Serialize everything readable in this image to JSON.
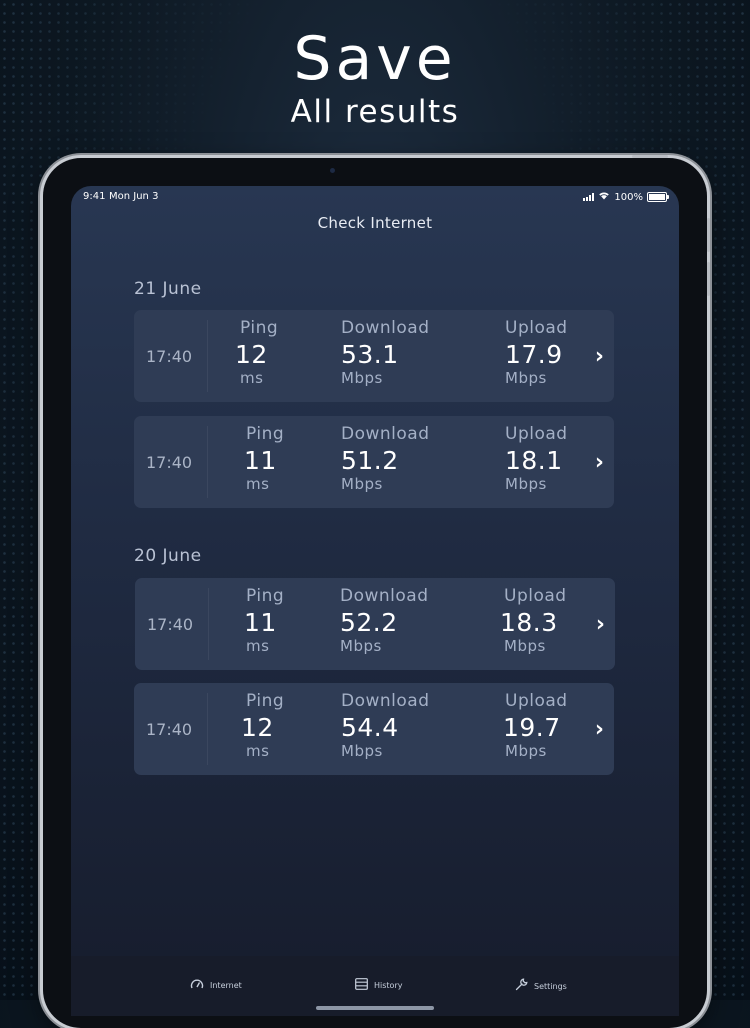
{
  "promo": {
    "headline": "Save",
    "subline": "All results"
  },
  "status_bar": {
    "time": "9:41",
    "date": "Mon Jun 3",
    "battery": "100%"
  },
  "nav": {
    "title": "Check Internet"
  },
  "labels": {
    "ping": "Ping",
    "download": "Download",
    "upload": "Upload",
    "ms": "ms",
    "mbps": "Mbps"
  },
  "sections": [
    {
      "date": "21 June",
      "results": [
        {
          "time": "17:40",
          "ping": "12",
          "download": "53.1",
          "upload": "17.9"
        },
        {
          "time": "17:40",
          "ping": "11",
          "download": "51.2",
          "upload": "18.1"
        }
      ]
    },
    {
      "date": "20 June",
      "results": [
        {
          "time": "17:40",
          "ping": "11",
          "download": "52.2",
          "upload": "18.3"
        },
        {
          "time": "17:40",
          "ping": "12",
          "download": "54.4",
          "upload": "19.7"
        }
      ]
    }
  ],
  "tabbar": {
    "tabs": [
      {
        "label": "Internet",
        "icon": "speedometer-icon"
      },
      {
        "label": "History",
        "icon": "list-icon"
      },
      {
        "label": "Settings",
        "icon": "wrench-icon"
      }
    ]
  }
}
